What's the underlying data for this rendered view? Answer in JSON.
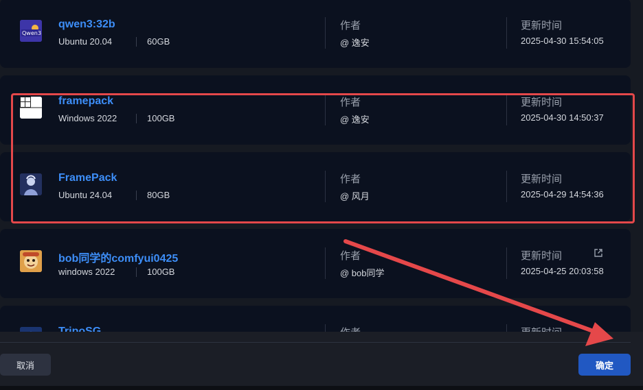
{
  "labels": {
    "author": "作者",
    "updated": "更新时间"
  },
  "images": [
    {
      "name": "qwen3:32b",
      "os": "Ubuntu 20.04",
      "size": "60GB",
      "author": "@ 逸安",
      "updated": "2025-04-30 15:54:05",
      "icon": "qwen-logo-icon"
    },
    {
      "name": "framepack",
      "os": "Windows 2022",
      "size": "100GB",
      "author": "@ 逸安",
      "updated": "2025-04-30 14:50:37",
      "icon": "framepack-thumbnail-icon"
    },
    {
      "name": "FramePack",
      "os": "Ubuntu 24.04",
      "size": "80GB",
      "author": "@ 风月",
      "updated": "2025-04-29 14:54:36",
      "icon": "framepack-avatar-icon"
    },
    {
      "name": "bob同学的comfyui0425",
      "os": "windows 2022",
      "size": "100GB",
      "author": "@ bob同学",
      "updated": "2025-04-25 20:03:58",
      "icon": "bob-avatar-icon"
    },
    {
      "name": "TripoSG",
      "os": "",
      "size": "",
      "author": "",
      "updated": "",
      "icon": "triposg-thumbnail-icon"
    }
  ],
  "footer": {
    "cancel_label": "取消",
    "confirm_label": "确定"
  },
  "annotation": {
    "highlight_color": "#e5484a",
    "arrow_color": "#e5484a"
  },
  "colors": {
    "link": "#3d8ef8",
    "card": "#0b111f",
    "primary_button": "#2158c2"
  }
}
